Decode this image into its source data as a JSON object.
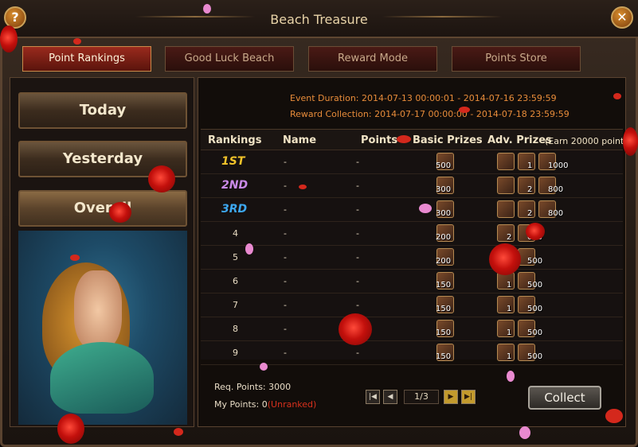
{
  "window": {
    "title": "Beach Treasure",
    "help_label": "?",
    "close_label": "✕"
  },
  "tabs": [
    {
      "label": "Point Rankings",
      "active": true
    },
    {
      "label": "Good Luck Beach",
      "active": false
    },
    {
      "label": "Reward Mode",
      "active": false
    },
    {
      "label": "Points Store",
      "active": false
    }
  ],
  "side_nav": [
    {
      "label": "Today",
      "active": false
    },
    {
      "label": "Yesterday",
      "active": false
    },
    {
      "label": "Overall",
      "active": true
    }
  ],
  "event": {
    "duration": "Event Duration: 2014-07-13 00:00:01 - 2014-07-16 23:59:59",
    "collection": "Reward Collection: 2014-07-17 00:00:00 - 2014-07-18 23:59:59"
  },
  "table": {
    "headers": {
      "rankings": "Rankings",
      "name": "Name",
      "points": "Points",
      "basic": "Basic Prizes",
      "adv": "Adv. Prizes",
      "adv_note": "(Earn 20000 point"
    },
    "rows": [
      {
        "rank": "1ST",
        "name": "-",
        "points": "-",
        "basic": "500",
        "adv": [
          "",
          "1",
          "1000"
        ],
        "color": "#f2c32a"
      },
      {
        "rank": "2ND",
        "name": "-",
        "points": "-",
        "basic": "300",
        "adv": [
          "",
          "2",
          "800"
        ],
        "color": "#c98ae8"
      },
      {
        "rank": "3RD",
        "name": "-",
        "points": "-",
        "basic": "300",
        "adv": [
          "",
          "2",
          "800"
        ],
        "color": "#3da8f0"
      },
      {
        "rank": "4",
        "name": "-",
        "points": "-",
        "basic": "200",
        "adv": [
          "2",
          "600"
        ]
      },
      {
        "rank": "5",
        "name": "-",
        "points": "-",
        "basic": "200",
        "adv": [
          "1",
          "500"
        ]
      },
      {
        "rank": "6",
        "name": "-",
        "points": "-",
        "basic": "150",
        "adv": [
          "1",
          "500"
        ]
      },
      {
        "rank": "7",
        "name": "-",
        "points": "-",
        "basic": "150",
        "adv": [
          "1",
          "500"
        ]
      },
      {
        "rank": "8",
        "name": "-",
        "points": "-",
        "basic": "150",
        "adv": [
          "1",
          "500"
        ]
      },
      {
        "rank": "9",
        "name": "-",
        "points": "-",
        "basic": "150",
        "adv": [
          "1",
          "500"
        ]
      }
    ]
  },
  "footer": {
    "req_points": "Req. Points: 3000",
    "my_points_label": "My Points: 0",
    "my_points_status": "(Unranked)",
    "page": "1/3",
    "collect_label": "Collect"
  },
  "colors": {
    "accent": "#e88c3a",
    "unranked": "#d8301c",
    "tab_active": "#9a2a1d"
  }
}
